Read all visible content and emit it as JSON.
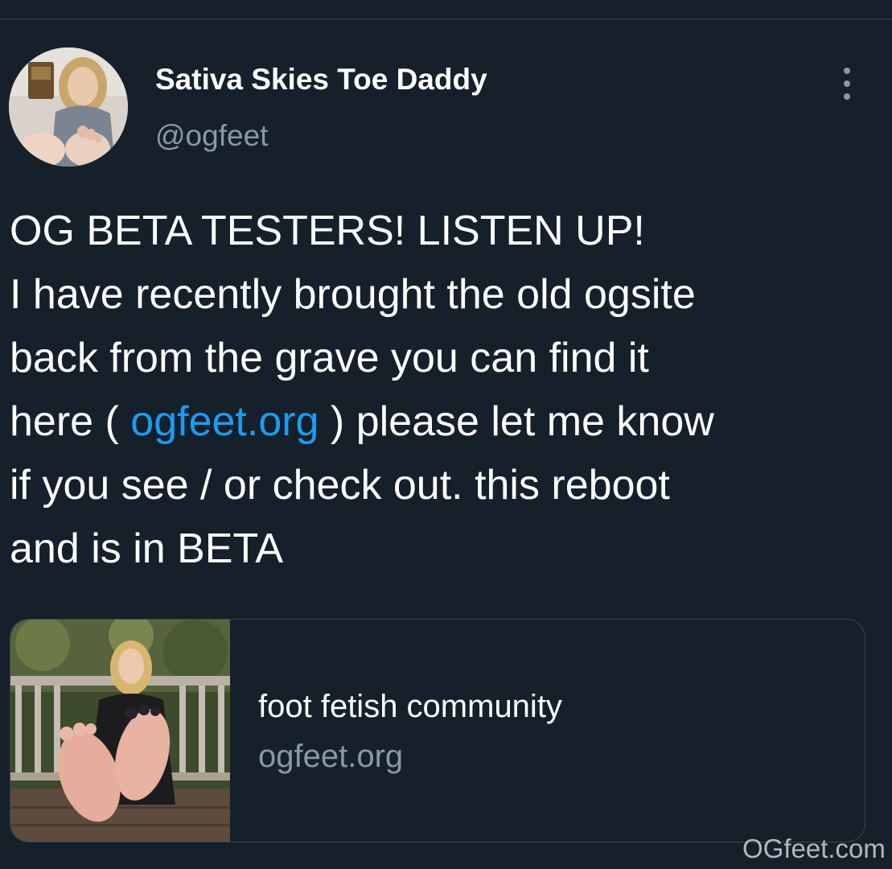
{
  "author": {
    "display_name": "Sativa Skies Toe Daddy",
    "handle": "@ogfeet",
    "avatar_icon": "profile-photo"
  },
  "menu": {
    "icon": "more-vertical-icon"
  },
  "tweet": {
    "lines": [
      "OG BETA TESTERS! LISTEN UP!",
      "I have recently brought the old ogsite",
      "back from the grave you can find it"
    ],
    "link_line_before": "here ( ",
    "link_text": "ogfeet.org",
    "link_line_after": " ) please let me know",
    "lines_after": [
      "if you see / or check out. this reboot",
      "and is in BETA"
    ]
  },
  "card": {
    "title": "foot fetish community",
    "domain": "ogfeet.org",
    "thumbnail_icon": "link-preview-photo"
  },
  "watermark": "OGfeet.com",
  "colors": {
    "background": "#15202b",
    "divider": "#38444d",
    "text_primary": "#ffffff",
    "text_secondary": "#8899a6",
    "link": "#1d9bf0"
  }
}
